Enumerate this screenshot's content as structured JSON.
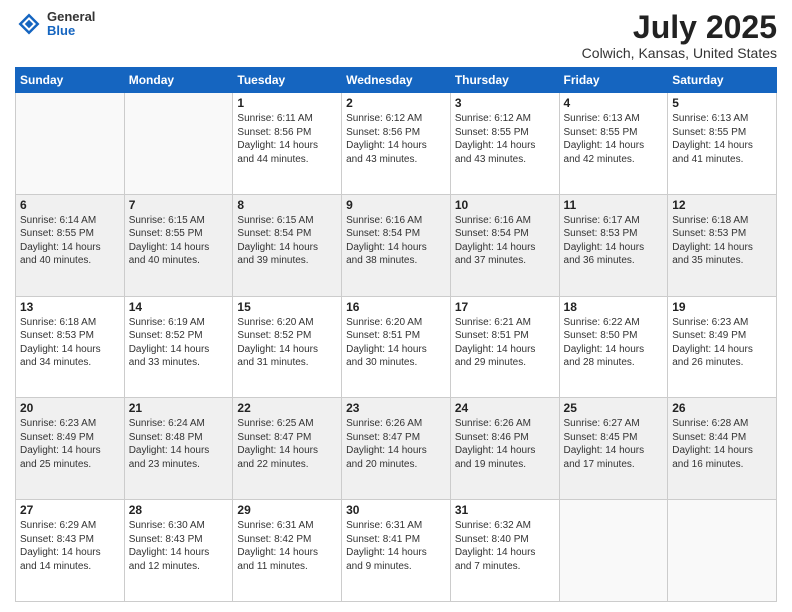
{
  "logo": {
    "general": "General",
    "blue": "Blue"
  },
  "header": {
    "title": "July 2025",
    "subtitle": "Colwich, Kansas, United States"
  },
  "days": [
    "Sunday",
    "Monday",
    "Tuesday",
    "Wednesday",
    "Thursday",
    "Friday",
    "Saturday"
  ],
  "weeks": [
    [
      {
        "day": "",
        "info": ""
      },
      {
        "day": "",
        "info": ""
      },
      {
        "day": "1",
        "info": "Sunrise: 6:11 AM\nSunset: 8:56 PM\nDaylight: 14 hours\nand 44 minutes."
      },
      {
        "day": "2",
        "info": "Sunrise: 6:12 AM\nSunset: 8:56 PM\nDaylight: 14 hours\nand 43 minutes."
      },
      {
        "day": "3",
        "info": "Sunrise: 6:12 AM\nSunset: 8:55 PM\nDaylight: 14 hours\nand 43 minutes."
      },
      {
        "day": "4",
        "info": "Sunrise: 6:13 AM\nSunset: 8:55 PM\nDaylight: 14 hours\nand 42 minutes."
      },
      {
        "day": "5",
        "info": "Sunrise: 6:13 AM\nSunset: 8:55 PM\nDaylight: 14 hours\nand 41 minutes."
      }
    ],
    [
      {
        "day": "6",
        "info": "Sunrise: 6:14 AM\nSunset: 8:55 PM\nDaylight: 14 hours\nand 40 minutes."
      },
      {
        "day": "7",
        "info": "Sunrise: 6:15 AM\nSunset: 8:55 PM\nDaylight: 14 hours\nand 40 minutes."
      },
      {
        "day": "8",
        "info": "Sunrise: 6:15 AM\nSunset: 8:54 PM\nDaylight: 14 hours\nand 39 minutes."
      },
      {
        "day": "9",
        "info": "Sunrise: 6:16 AM\nSunset: 8:54 PM\nDaylight: 14 hours\nand 38 minutes."
      },
      {
        "day": "10",
        "info": "Sunrise: 6:16 AM\nSunset: 8:54 PM\nDaylight: 14 hours\nand 37 minutes."
      },
      {
        "day": "11",
        "info": "Sunrise: 6:17 AM\nSunset: 8:53 PM\nDaylight: 14 hours\nand 36 minutes."
      },
      {
        "day": "12",
        "info": "Sunrise: 6:18 AM\nSunset: 8:53 PM\nDaylight: 14 hours\nand 35 minutes."
      }
    ],
    [
      {
        "day": "13",
        "info": "Sunrise: 6:18 AM\nSunset: 8:53 PM\nDaylight: 14 hours\nand 34 minutes."
      },
      {
        "day": "14",
        "info": "Sunrise: 6:19 AM\nSunset: 8:52 PM\nDaylight: 14 hours\nand 33 minutes."
      },
      {
        "day": "15",
        "info": "Sunrise: 6:20 AM\nSunset: 8:52 PM\nDaylight: 14 hours\nand 31 minutes."
      },
      {
        "day": "16",
        "info": "Sunrise: 6:20 AM\nSunset: 8:51 PM\nDaylight: 14 hours\nand 30 minutes."
      },
      {
        "day": "17",
        "info": "Sunrise: 6:21 AM\nSunset: 8:51 PM\nDaylight: 14 hours\nand 29 minutes."
      },
      {
        "day": "18",
        "info": "Sunrise: 6:22 AM\nSunset: 8:50 PM\nDaylight: 14 hours\nand 28 minutes."
      },
      {
        "day": "19",
        "info": "Sunrise: 6:23 AM\nSunset: 8:49 PM\nDaylight: 14 hours\nand 26 minutes."
      }
    ],
    [
      {
        "day": "20",
        "info": "Sunrise: 6:23 AM\nSunset: 8:49 PM\nDaylight: 14 hours\nand 25 minutes."
      },
      {
        "day": "21",
        "info": "Sunrise: 6:24 AM\nSunset: 8:48 PM\nDaylight: 14 hours\nand 23 minutes."
      },
      {
        "day": "22",
        "info": "Sunrise: 6:25 AM\nSunset: 8:47 PM\nDaylight: 14 hours\nand 22 minutes."
      },
      {
        "day": "23",
        "info": "Sunrise: 6:26 AM\nSunset: 8:47 PM\nDaylight: 14 hours\nand 20 minutes."
      },
      {
        "day": "24",
        "info": "Sunrise: 6:26 AM\nSunset: 8:46 PM\nDaylight: 14 hours\nand 19 minutes."
      },
      {
        "day": "25",
        "info": "Sunrise: 6:27 AM\nSunset: 8:45 PM\nDaylight: 14 hours\nand 17 minutes."
      },
      {
        "day": "26",
        "info": "Sunrise: 6:28 AM\nSunset: 8:44 PM\nDaylight: 14 hours\nand 16 minutes."
      }
    ],
    [
      {
        "day": "27",
        "info": "Sunrise: 6:29 AM\nSunset: 8:43 PM\nDaylight: 14 hours\nand 14 minutes."
      },
      {
        "day": "28",
        "info": "Sunrise: 6:30 AM\nSunset: 8:43 PM\nDaylight: 14 hours\nand 12 minutes."
      },
      {
        "day": "29",
        "info": "Sunrise: 6:31 AM\nSunset: 8:42 PM\nDaylight: 14 hours\nand 11 minutes."
      },
      {
        "day": "30",
        "info": "Sunrise: 6:31 AM\nSunset: 8:41 PM\nDaylight: 14 hours\nand 9 minutes."
      },
      {
        "day": "31",
        "info": "Sunrise: 6:32 AM\nSunset: 8:40 PM\nDaylight: 14 hours\nand 7 minutes."
      },
      {
        "day": "",
        "info": ""
      },
      {
        "day": "",
        "info": ""
      }
    ]
  ]
}
